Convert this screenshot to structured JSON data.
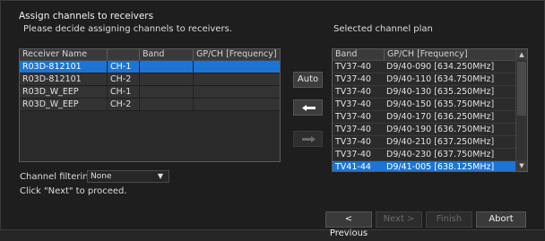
{
  "dialog": {
    "title": "Assign channels to receivers",
    "subtitle": "Please decide assigning channels to receivers.",
    "right_caption": "Selected channel plan"
  },
  "receivers_table": {
    "columns": [
      "Receiver Name",
      "",
      "Band",
      "GP/CH [Frequency]"
    ],
    "rows": [
      {
        "name": "R03D-812101",
        "ch": "CH-1",
        "band": "",
        "gpch": "",
        "selected": true
      },
      {
        "name": "R03D-812101",
        "ch": "CH-2",
        "band": "",
        "gpch": "",
        "selected": false
      },
      {
        "name": "R03D_W_EEP",
        "ch": "CH-1",
        "band": "",
        "gpch": "",
        "selected": false
      },
      {
        "name": "R03D_W_EEP",
        "ch": "CH-2",
        "band": "",
        "gpch": "",
        "selected": false
      }
    ]
  },
  "side_buttons": {
    "auto_label": "Auto",
    "assign_icon": "arrow-left-icon",
    "unassign_icon": "arrow-right-icon"
  },
  "channel_plan": {
    "columns": [
      "Band",
      "GP/CH [Frequency]"
    ],
    "rows": [
      {
        "band": "TV37-40",
        "gpch": "D9/40-090 [634.250MHz]",
        "selected": false
      },
      {
        "band": "TV37-40",
        "gpch": "D9/40-110 [634.750MHz]",
        "selected": false
      },
      {
        "band": "TV37-40",
        "gpch": "D9/40-130 [635.250MHz]",
        "selected": false
      },
      {
        "band": "TV37-40",
        "gpch": "D9/40-150 [635.750MHz]",
        "selected": false
      },
      {
        "band": "TV37-40",
        "gpch": "D9/40-170 [636.250MHz]",
        "selected": false
      },
      {
        "band": "TV37-40",
        "gpch": "D9/40-190 [636.750MHz]",
        "selected": false
      },
      {
        "band": "TV37-40",
        "gpch": "D9/40-210 [637.250MHz]",
        "selected": false
      },
      {
        "band": "TV37-40",
        "gpch": "D9/40-230 [637.750MHz]",
        "selected": false
      },
      {
        "band": "TV41-44",
        "gpch": "D9/41-005 [638.125MHz]",
        "selected": true
      }
    ]
  },
  "filter": {
    "label": "Channel filtering",
    "value": "None"
  },
  "hint": "Click \"Next\" to proceed.",
  "buttons": {
    "previous": "< Previous",
    "next": "Next >",
    "finish": "Finish",
    "abort": "Abort"
  },
  "colors": {
    "selection": "#1c74d4",
    "background": "#1e1e1e"
  }
}
